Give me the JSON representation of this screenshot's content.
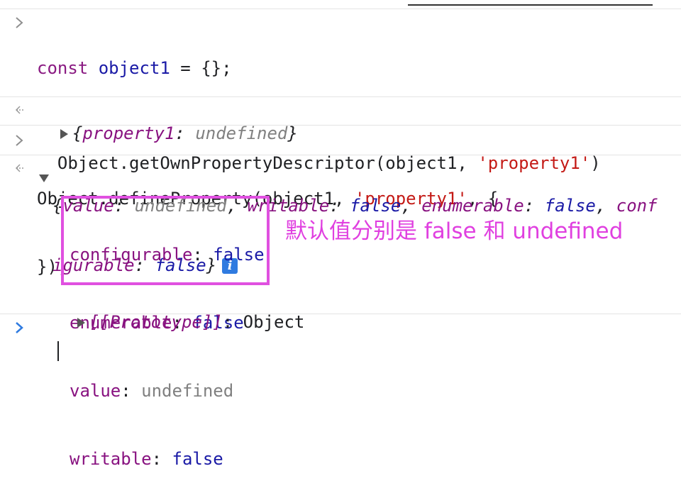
{
  "console": {
    "entry1": {
      "line1": {
        "keyword": "const",
        "var": "object1",
        "rest": " = {};"
      },
      "line3": {
        "obj": "Object",
        "fn": ".defineProperty(object1, ",
        "str": "'property1'",
        "tail": ", {"
      },
      "line4": "});"
    },
    "result1": {
      "open": "{",
      "key": "property1",
      "colon": ": ",
      "val": "undefined",
      "close": "}"
    },
    "entry2": {
      "fn": "Object.getOwnPropertyDescriptor(object1, ",
      "str": "'property1'",
      "tail": ")"
    },
    "result2": {
      "summary1": {
        "open": "{",
        "k1": "value",
        "v1": "undefined",
        "k2": "writable",
        "v2": "false",
        "k3": "enumerable",
        "v3": "false",
        "k4part": "conf"
      },
      "summary2": {
        "k4rest": "igurable",
        "v4": "false",
        "close": "}"
      },
      "info_label": "i",
      "props": [
        {
          "key": "configurable",
          "value": "false"
        },
        {
          "key": "enumerable",
          "value": "false"
        },
        {
          "key": "value",
          "value": "undefined"
        },
        {
          "key": "writable",
          "value": "false"
        }
      ],
      "prototype": {
        "key": "[[Prototype]]",
        "value": "Object"
      }
    }
  },
  "annotation": "默认值分别是 false 和 undefined",
  "colors": {
    "annotation": "#e040e0",
    "prompt": "#2f7be0"
  }
}
